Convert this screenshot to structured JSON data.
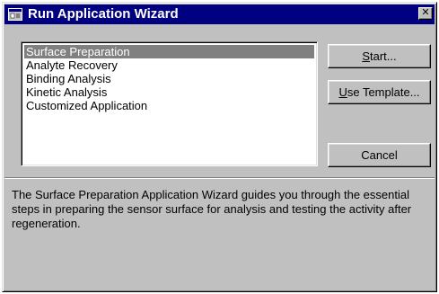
{
  "window": {
    "title": "Run Application Wizard",
    "close_label": "✕"
  },
  "applications": {
    "items": [
      "Surface Preparation",
      "Analyte Recovery",
      "Binding Analysis",
      "Kinetic Analysis",
      "Customized Application"
    ],
    "selected": "Surface Preparation"
  },
  "buttons": {
    "start_mnemonic": "S",
    "start_rest": "tart...",
    "template_mnemonic": "U",
    "template_rest": "se Template...",
    "cancel": "Cancel"
  },
  "description": "The Surface Preparation Application Wizard guides you through the essential steps in preparing the sensor surface for analysis and testing the activity after regeneration.",
  "icons": {
    "title": "window-app-icon",
    "close": "close-icon"
  },
  "colors": {
    "titlebar": "#000080",
    "face": "#c0c0c0",
    "selection": "#808080"
  }
}
